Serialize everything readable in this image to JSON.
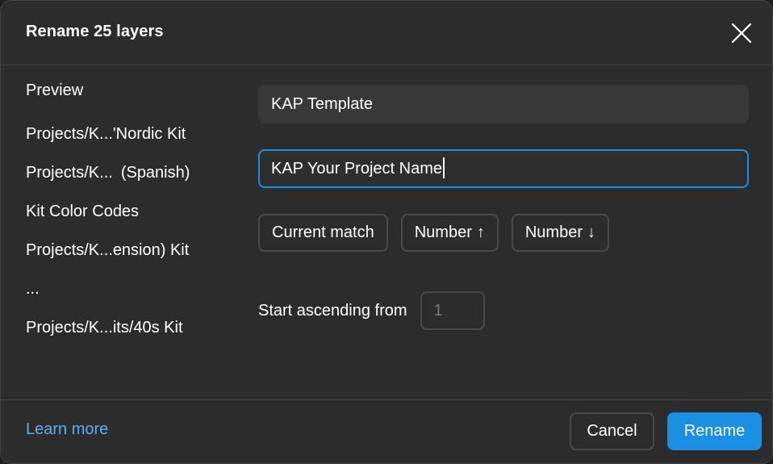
{
  "dialog": {
    "title": "Rename 25 layers",
    "close_icon": "close-icon"
  },
  "preview": {
    "heading": "Preview",
    "items": [
      {
        "head": "Projects/K...",
        "tail": "'Nordic Kit"
      },
      {
        "head": "Projects/K...",
        "tail": "(Spanish)"
      },
      {
        "head": "Kit Color Codes",
        "tail": ""
      },
      {
        "head": "Projects/K...",
        "tail": "ension) Kit"
      },
      {
        "head": "...",
        "tail": ""
      },
      {
        "head": "Projects/K...",
        "tail": "its/40s Kit"
      }
    ]
  },
  "find": {
    "value": "KAP Template"
  },
  "replace": {
    "value": "KAP Your Project Name"
  },
  "chips": {
    "current_match": "Current match",
    "number_up": "Number",
    "number_up_arrow": "↑",
    "number_down": "Number",
    "number_down_arrow": "↓"
  },
  "start": {
    "label": "Start ascending from",
    "placeholder": "1"
  },
  "footer": {
    "learn_more": "Learn more",
    "cancel": "Cancel",
    "rename": "Rename"
  },
  "colors": {
    "accent": "#1a8fe3",
    "link": "#5eb0ef",
    "dialog_bg": "#2c2c2c"
  }
}
